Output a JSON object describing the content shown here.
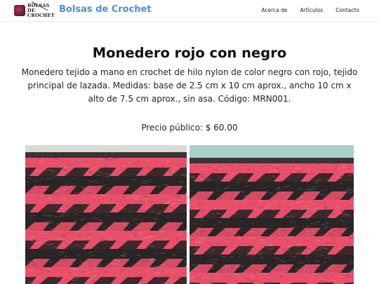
{
  "header": {
    "logo_lines": [
      "BOLSAS DE",
      "CROCHET"
    ],
    "site_title": "Bolsas de Crochet",
    "nav": [
      {
        "label": "Acerca de"
      },
      {
        "label": "Artículos"
      },
      {
        "label": "Contacto"
      }
    ]
  },
  "product": {
    "title": "Monedero rojo con negro",
    "description": "Monedero tejido a mano en crochet de hilo nylon de color negro con rojo, tejido principal de lazada. Medidas: base de 2.5 cm x 10 cm aprox., ancho 10 cm x alto de 7.5 cm aprox., sin asa. Código: MRN001.",
    "price": "Precio público: $ 60.00"
  },
  "colors": {
    "site_title": "#4a8fd3",
    "yarn_red": "#e8506a",
    "yarn_black": "#2a2526",
    "photo_bg_left": "#d9d9d6",
    "photo_bg_right": "#a9cfc9"
  }
}
